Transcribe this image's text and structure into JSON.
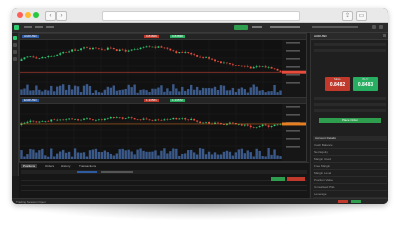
{
  "window": {
    "title": ""
  },
  "chart_panels": [
    {
      "symbol_badge": "AUDUSD",
      "sell_price": "0.84826",
      "buy_price": "0.84838",
      "price_line_color": "#e74c3c",
      "candle_up_color": "#2ecc71",
      "candle_down_color": "#e74c3c",
      "volume_color": "#3b5a8a"
    },
    {
      "symbol_badge": "EURUSD",
      "sell_price": "1.13561",
      "buy_price": "1.13572",
      "price_line_color": "#e67e22",
      "candle_up_color": "#2ecc71",
      "candle_down_color": "#e74c3c",
      "volume_color": "#3b5a8a"
    }
  ],
  "trade_ticket": {
    "title": "AUDUSD",
    "sell_label": "SELL",
    "sell_price": "0.8482",
    "buy_label": "BUY",
    "buy_price": "0.8483",
    "place_order_label": "Place Order",
    "sell_color": "#c0392b",
    "buy_color": "#27ae60"
  },
  "account_summary": {
    "header": "Account Details",
    "rows": [
      "Cash Balance",
      "Net Equity",
      "Margin Used",
      "Free Margin",
      "Margin Level",
      "Position Value",
      "Unrealised P&L",
      "Leverage"
    ]
  },
  "bottom_panel": {
    "tabs": [
      "Positions",
      "Orders",
      "History",
      "Transactions"
    ],
    "active_tab": 0,
    "row_count": 3
  },
  "status_bar": {
    "status_text": "Trading Session Open"
  }
}
